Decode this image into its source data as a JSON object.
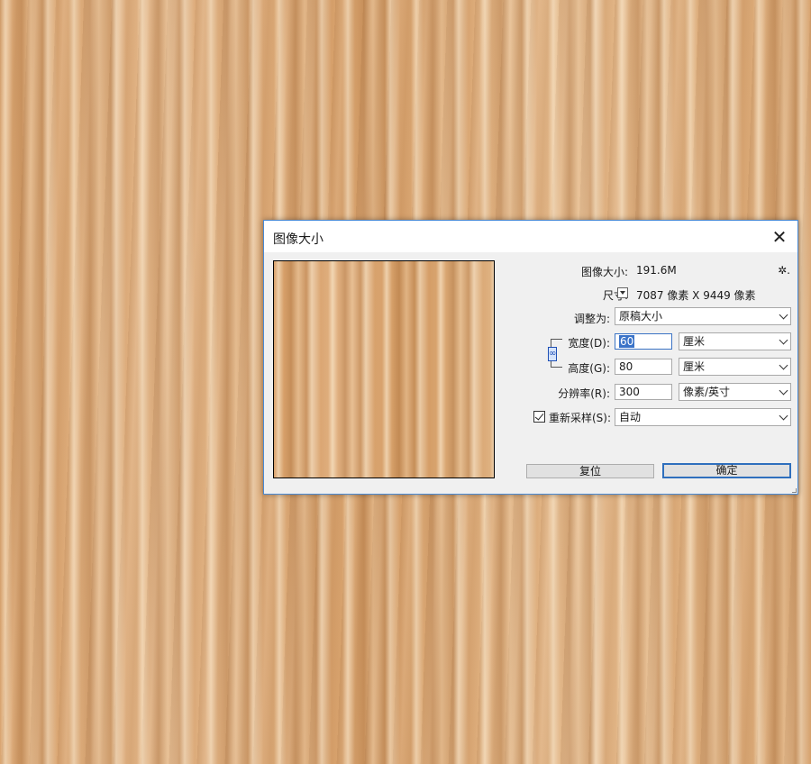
{
  "dialog": {
    "title": "图像大小",
    "close_glyph": "✕",
    "image_size_label": "图像大小:",
    "image_size_value": "191.6M",
    "dimensions_label": "尺寸:",
    "dimensions_value": "7087 像素  X  9449 像素",
    "fit_to_label": "调整为:",
    "fit_to_value": "原稿大小",
    "width_label": "宽度(D):",
    "width_value": "60",
    "width_unit": "厘米",
    "height_label": "高度(G):",
    "height_value": "80",
    "height_unit": "厘米",
    "resolution_label": "分辨率(R):",
    "resolution_value": "300",
    "resolution_unit": "像素/英寸",
    "resample_label": "重新采样(S):",
    "resample_value": "自动",
    "resample_checked": true,
    "reset_button": "复位",
    "ok_button": "确定",
    "gear_glyph": "✲."
  },
  "colors": {
    "accent": "#2f6fbd",
    "selection": "#3a73c8"
  }
}
